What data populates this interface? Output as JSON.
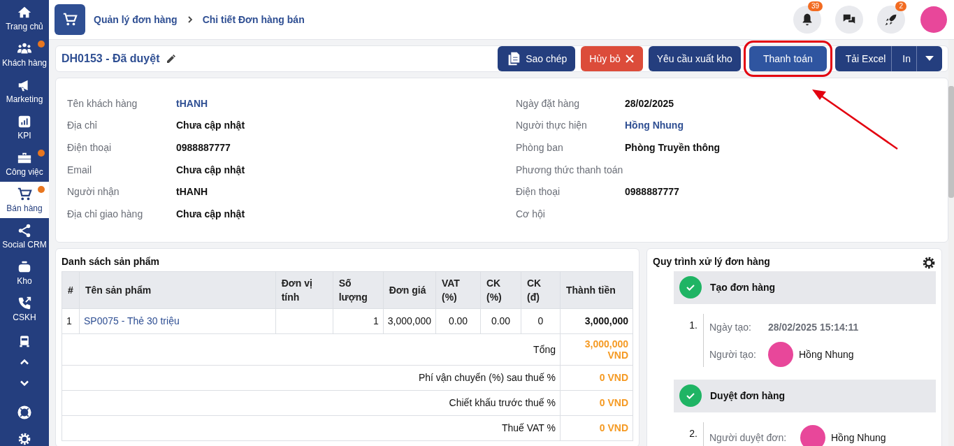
{
  "sidebar": {
    "items": [
      {
        "label": "Trang chủ",
        "selected": false,
        "dot": false
      },
      {
        "label": "Khách hàng",
        "selected": false,
        "dot": true
      },
      {
        "label": "Marketing",
        "selected": false,
        "dot": false
      },
      {
        "label": "KPI",
        "selected": false,
        "dot": false
      },
      {
        "label": "Công việc",
        "selected": false,
        "dot": true
      },
      {
        "label": "Bán hàng",
        "selected": true,
        "dot": true
      },
      {
        "label": "Social CRM",
        "selected": false,
        "dot": false
      },
      {
        "label": "Kho",
        "selected": false,
        "dot": false
      },
      {
        "label": "CSKH",
        "selected": false,
        "dot": false
      }
    ]
  },
  "breadcrumb": [
    "Quản lý đơn hàng",
    "Chi tiết Đơn hàng bán"
  ],
  "top_icons": [
    {
      "kind": "bell",
      "badge": "39"
    },
    {
      "kind": "chat"
    },
    {
      "kind": "rocket",
      "badge": "2"
    }
  ],
  "order": {
    "title": "DH0153 - Đã duyệt",
    "buttons": [
      {
        "label": "Sao chép",
        "kind": "copy",
        "highlighted": false
      },
      {
        "label": "Hủy bỏ",
        "kind": "danger",
        "highlighted": false
      },
      {
        "label": "Yêu cầu xuất kho",
        "kind": "primary",
        "highlighted": false
      },
      {
        "label": "Thanh toán",
        "kind": "primary",
        "highlighted": true
      }
    ],
    "split_button": [
      "Tải Excel",
      "In"
    ]
  },
  "info": {
    "left": [
      {
        "label": "Tên khách hàng",
        "value": "tHANH",
        "kind": "link"
      },
      {
        "label": "Địa chỉ",
        "value": "Chưa cập nhật",
        "kind": "bold"
      },
      {
        "label": "Điện thoại",
        "value": "0988887777",
        "kind": "bold"
      },
      {
        "label": "Email",
        "value": "Chưa cập nhật",
        "kind": "bold"
      },
      {
        "label": "Người nhận",
        "value": "tHANH",
        "kind": "bold"
      },
      {
        "label": "Địa chỉ giao hàng",
        "value": "Chưa cập nhật",
        "kind": "bold"
      }
    ],
    "right": [
      {
        "label": "Ngày đặt hàng",
        "value": "28/02/2025",
        "kind": "bold"
      },
      {
        "label": "Người thực hiện",
        "value": "Hồng Nhung",
        "kind": "link"
      },
      {
        "label": "Phòng ban",
        "value": "Phòng Truyền thông",
        "kind": "bold"
      },
      {
        "label": "Phương thức thanh toán"
      },
      {
        "label": "Điện thoại",
        "value": "0988887777",
        "kind": "bold"
      },
      {
        "label": "Cơ hội"
      }
    ]
  },
  "products": {
    "title": "Danh sách sản phẩm",
    "columns": [
      "#",
      "Tên sản phẩm",
      "Đơn vị tính",
      "Số lượng",
      "Đơn giá",
      "VAT (%)",
      "CK (%)",
      "CK (đ)",
      "Thành tiền"
    ],
    "rows": [
      [
        "1",
        "SP0075 - Thẻ 30 triệu",
        "",
        "1",
        "3,000,000",
        "0.00",
        "0.00",
        "0",
        "3,000,000"
      ]
    ],
    "summary": [
      {
        "label": "Tổng",
        "value": "3,000,000 VND"
      },
      {
        "label": "Phí vận chuyển (%) sau thuế %",
        "value": "0 VND"
      },
      {
        "label": "Chiết khấu trước thuế %",
        "value": "0 VND"
      },
      {
        "label": "Thuế VAT %",
        "value": "0 VND"
      }
    ]
  },
  "process": {
    "title": "Quy trình xử lý đơn hàng",
    "steps": [
      {
        "title": "Tạo đơn hàng",
        "done": true,
        "number": "1.",
        "fields": [
          {
            "label": "Ngày tạo:",
            "value": "28/02/2025 15:14:11",
            "kind": "text"
          },
          {
            "label": "Người tạo:",
            "value": "Hồng Nhung",
            "kind": "person"
          }
        ]
      },
      {
        "title": "Duyệt đơn hàng",
        "done": true,
        "number": "2.",
        "fields": [
          {
            "label": "Người duyệt đơn:",
            "value": "Hồng Nhung",
            "kind": "person"
          }
        ]
      }
    ]
  }
}
